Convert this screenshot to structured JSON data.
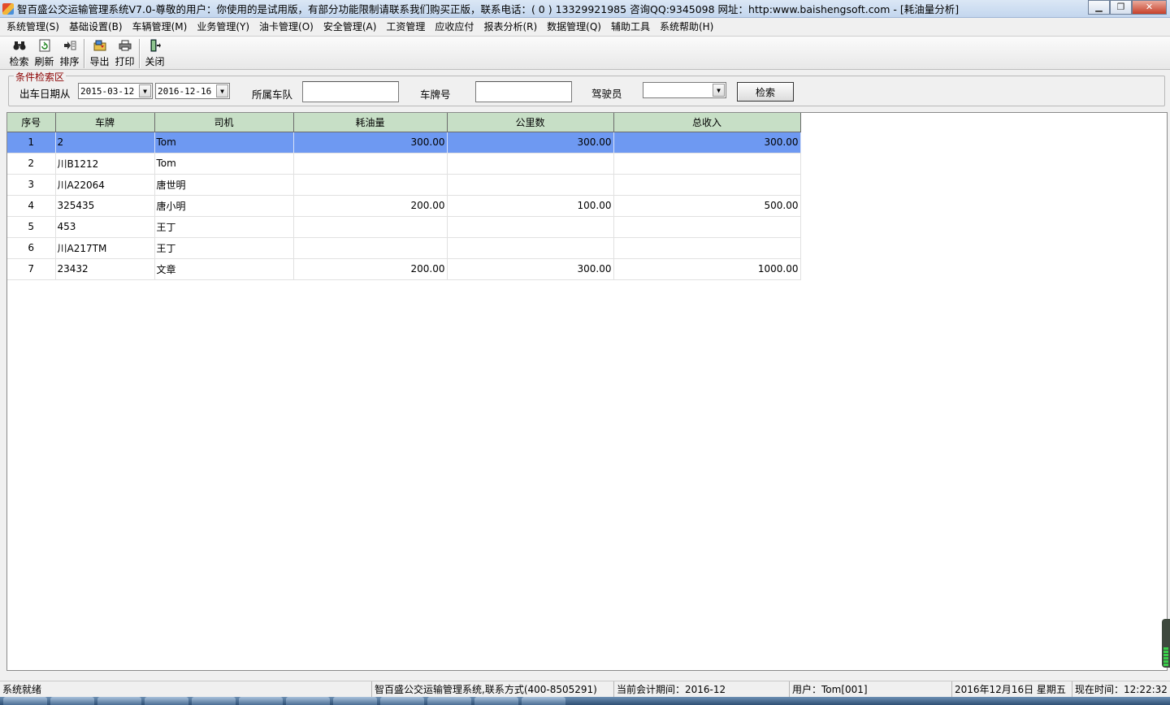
{
  "window": {
    "title": "智百盛公交运输管理系统V7.0-尊敬的用户：你使用的是试用版，有部分功能限制请联系我们购买正版，联系电话：( 0 ) 13329921985 咨询QQ:9345098 网址：http:www.baishengsoft.com - [耗油量分析]",
    "min_label": "▁",
    "restore_label": "❐",
    "close_label": "✕"
  },
  "menu": [
    "系统管理(S)",
    "基础设置(B)",
    "车辆管理(M)",
    "业务管理(Y)",
    "油卡管理(O)",
    "安全管理(A)",
    "工资管理",
    "应收应付",
    "报表分析(R)",
    "数据管理(Q)",
    "辅助工具",
    "系统帮助(H)"
  ],
  "toolbar": {
    "search": "检索",
    "refresh": "刷新",
    "sort": "排序",
    "export": "导出",
    "print": "打印",
    "close": "关闭"
  },
  "search": {
    "legend": "条件检索区",
    "date_label": "出车日期从",
    "date_from": "2015-03-12",
    "date_to": "2016-12-16",
    "team_label": "所属车队",
    "team_value": "",
    "plate_label": "车牌号",
    "plate_value": "",
    "driver_label": "驾驶员",
    "driver_value": "",
    "button": "检索"
  },
  "grid": {
    "columns": [
      "序号",
      "车牌",
      "司机",
      "耗油量",
      "公里数",
      "总收入"
    ],
    "rows": [
      [
        "1",
        "2",
        "Tom",
        "300.00",
        "300.00",
        "300.00"
      ],
      [
        "2",
        "川B1212",
        "Tom",
        "",
        "",
        ""
      ],
      [
        "3",
        "川A22064",
        "唐世明",
        "",
        "",
        ""
      ],
      [
        "4",
        "325435",
        "唐小明",
        "200.00",
        "100.00",
        "500.00"
      ],
      [
        "5",
        "453",
        "王丁",
        "",
        "",
        ""
      ],
      [
        "6",
        "川A217TM",
        "王丁",
        "",
        "",
        ""
      ],
      [
        "7",
        "23432",
        "文章",
        "200.00",
        "300.00",
        "1000.00"
      ]
    ],
    "selected_row": 0
  },
  "status": {
    "ready": "系统就绪",
    "company": "智百盛公交运输管理系统,联系方式(400-8505291)",
    "period": "当前会计期间：2016-12",
    "user": "用户：Tom[001]",
    "date": "2016年12月16日 星期五",
    "time": "现在时间：12:22:32"
  },
  "colors": {
    "header_bg": "#c7dfc6",
    "selection_bg": "#6e99f2",
    "legend_text": "#8b0000"
  }
}
